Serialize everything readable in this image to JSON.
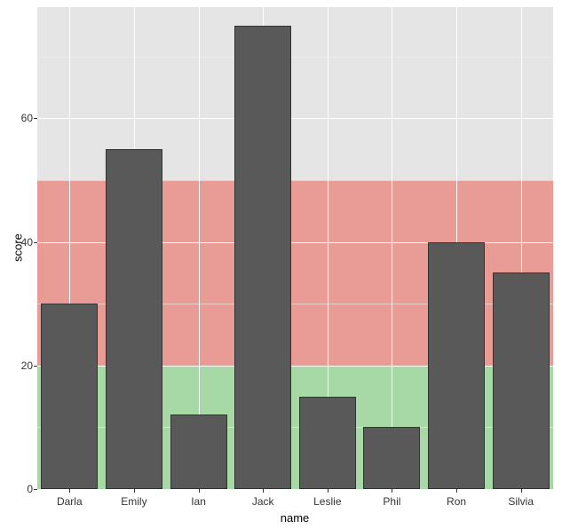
{
  "chart_data": {
    "type": "bar",
    "categories": [
      "Darla",
      "Emily",
      "Ian",
      "Jack",
      "Leslie",
      "Phil",
      "Ron",
      "Silvia"
    ],
    "values": [
      30,
      55,
      12,
      75,
      15,
      10,
      40,
      35
    ],
    "xlabel": "name",
    "ylabel": "score",
    "ylim": [
      0,
      78
    ],
    "y_ticks": [
      0,
      20,
      40,
      60
    ],
    "y_minor_ticks": [
      10,
      30,
      50,
      70
    ],
    "bands": [
      {
        "from": 0,
        "to": 20,
        "color": "#a6d9a6"
      },
      {
        "from": 20,
        "to": 50,
        "color": "#e99b95"
      }
    ],
    "panel_bg": "#e5e5e5",
    "bar_color": "#595959"
  }
}
